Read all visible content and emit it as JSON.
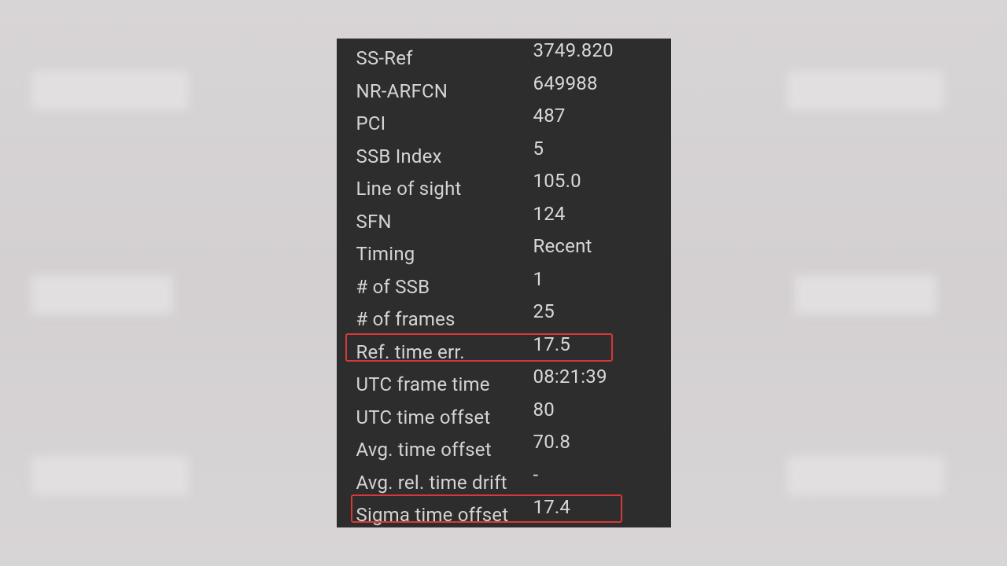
{
  "panel": {
    "rows": [
      {
        "label": "SS-Ref",
        "value": "3749.820"
      },
      {
        "label": "NR-ARFCN",
        "value": "649988"
      },
      {
        "label": "PCI",
        "value": "487"
      },
      {
        "label": "SSB Index",
        "value": "5"
      },
      {
        "label": "Line of sight",
        "value": "105.0"
      },
      {
        "label": "SFN",
        "value": "124"
      },
      {
        "label": "Timing",
        "value": "Recent"
      },
      {
        "label": "# of SSB",
        "value": "1"
      },
      {
        "label": "# of frames",
        "value": "25"
      },
      {
        "label": "Ref. time err.",
        "value": "17.5"
      },
      {
        "label": "UTC frame time",
        "value": "08:21:39"
      },
      {
        "label": "UTC time offset",
        "value": "80"
      },
      {
        "label": "Avg. time offset",
        "value": "70.8"
      },
      {
        "label": "Avg. rel. time drift",
        "value": "-"
      },
      {
        "label": "Sigma time offset",
        "value": "17.4"
      }
    ]
  }
}
